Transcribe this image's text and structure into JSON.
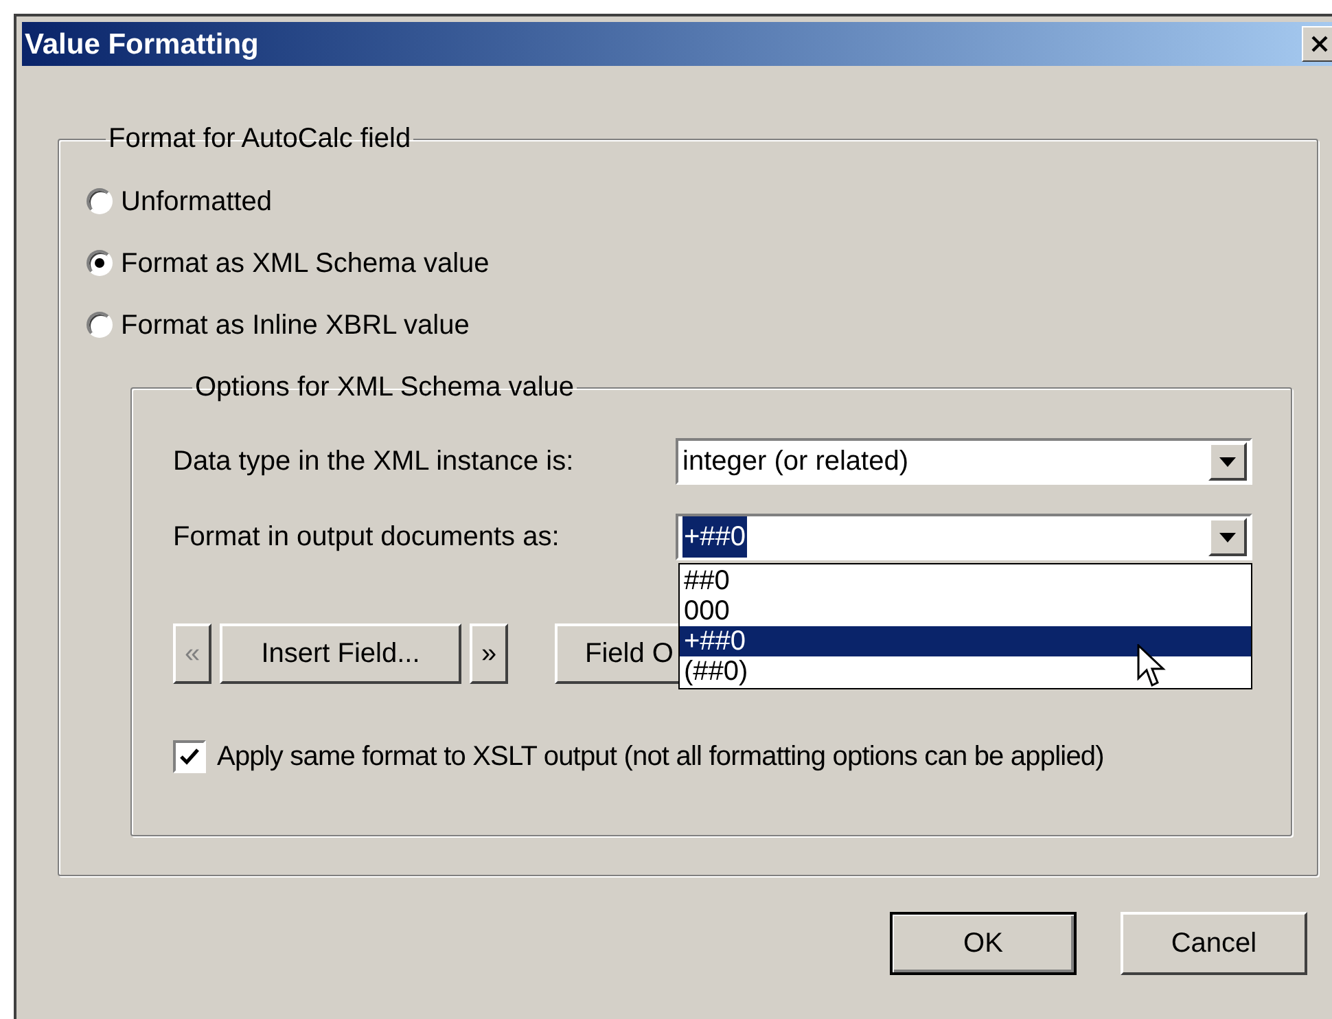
{
  "window": {
    "title": "Value Formatting"
  },
  "format_group": {
    "title": "Format for AutoCalc field",
    "options": [
      {
        "label": "Unformatted",
        "selected": false
      },
      {
        "label": "Format as XML Schema value",
        "selected": true
      },
      {
        "label": "Format as Inline XBRL value",
        "selected": false
      }
    ]
  },
  "options_group": {
    "title": "Options for XML Schema value",
    "data_type": {
      "label": "Data type in the XML instance is:",
      "value": "integer (or related)"
    },
    "output_format": {
      "label": "Format in output documents as:",
      "value": "+##0",
      "expanded": true,
      "items": [
        {
          "label": "##0",
          "selected": false
        },
        {
          "label": "000",
          "selected": false
        },
        {
          "label": "+##0",
          "selected": true
        },
        {
          "label": "(##0)",
          "selected": false
        }
      ]
    },
    "buttons": [
      {
        "label": "«",
        "disabled": true
      },
      {
        "label": "Insert Field...",
        "disabled": false
      },
      {
        "label": "»",
        "disabled": false
      },
      {
        "label": "Field O",
        "disabled": false
      }
    ],
    "apply_xslt": {
      "label": "Apply same format to XSLT output (not all formatting options can be applied)",
      "checked": true
    }
  },
  "buttons": [
    {
      "label": "OK",
      "default": true
    },
    {
      "label": "Cancel",
      "default": false
    }
  ]
}
